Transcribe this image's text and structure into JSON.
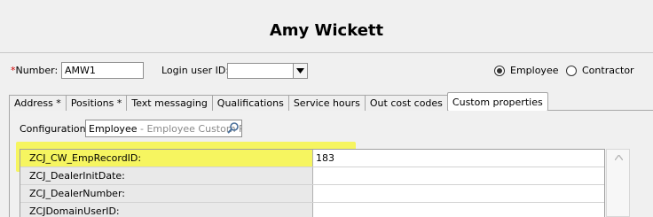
{
  "header": {
    "title": "Amy Wickett"
  },
  "form": {
    "number_required_mark": "*",
    "number_label": "Number:",
    "number_value": "AMW1",
    "login_label": "Login user ID:",
    "login_value": "",
    "type_options": [
      {
        "label": "Employee",
        "selected": true
      },
      {
        "label": "Contractor",
        "selected": false
      }
    ]
  },
  "tabs": [
    {
      "label": "Address *",
      "active": false
    },
    {
      "label": "Positions *",
      "active": false
    },
    {
      "label": "Text messaging",
      "active": false
    },
    {
      "label": "Qualifications",
      "active": false
    },
    {
      "label": "Service hours",
      "active": false
    },
    {
      "label": "Out cost codes",
      "active": false
    },
    {
      "label": "Custom properties",
      "active": true
    }
  ],
  "configuration": {
    "label": "Configuration:",
    "value": "Employee",
    "hint": " - Employee Custom Pr"
  },
  "properties": [
    {
      "name": "ZCJ_CW_EmpRecordID:",
      "value": "183"
    },
    {
      "name": "ZCJ_DealerInitDate:",
      "value": ""
    },
    {
      "name": "ZCJ_DealerNumber:",
      "value": ""
    },
    {
      "name": "ZCJDomainUserID:",
      "value": ""
    }
  ],
  "colors": {
    "highlight": "#f6f560",
    "required": "#d00000"
  }
}
